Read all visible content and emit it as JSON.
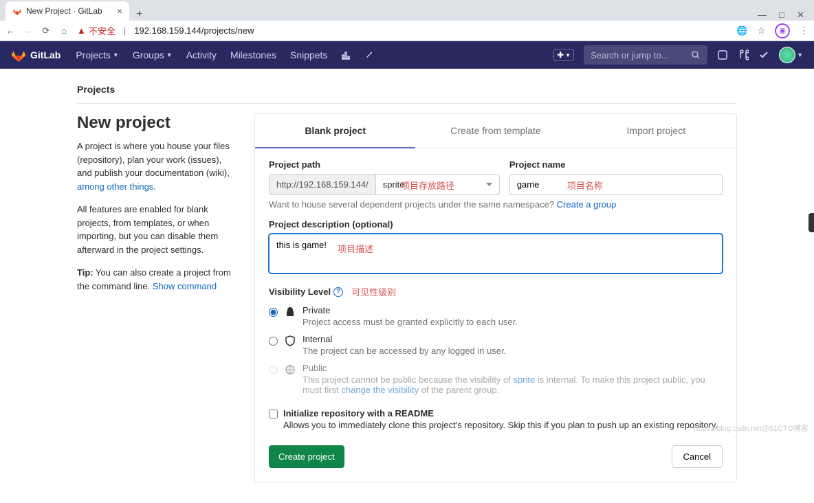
{
  "browser": {
    "tab_title": "New Project · GitLab",
    "insecure_label": "不安全",
    "url": "192.168.159.144/projects/new"
  },
  "header": {
    "brand": "GitLab",
    "nav": {
      "projects": "Projects",
      "groups": "Groups",
      "activity": "Activity",
      "milestones": "Milestones",
      "snippets": "Snippets"
    },
    "search_placeholder": "Search or jump to..."
  },
  "breadcrumb": "Projects",
  "side": {
    "title": "New project",
    "p1a": "A project is where you house your files (repository), plan your work (issues), and publish your documentation (wiki), ",
    "p1_link": "among other things",
    "p2": "All features are enabled for blank projects, from templates, or when importing, but you can disable them afterward in the project settings.",
    "tip_label": "Tip:",
    "tip_text": " You can also create a project from the command line. ",
    "tip_link": "Show command"
  },
  "tabs": {
    "blank": "Blank project",
    "template": "Create from template",
    "import": "Import project"
  },
  "form": {
    "path_label": "Project path",
    "path_prefix": "http://192.168.159.144/",
    "path_namespace": "sprite",
    "name_label": "Project name",
    "name_value": "game",
    "house_hint": "Want to house several dependent projects under the same namespace? ",
    "create_group": "Create a group",
    "desc_label": "Project description (optional)",
    "desc_value": "this is game!",
    "vis_label": "Visibility Level",
    "private_title": "Private",
    "private_sub": "Project access must be granted explicitly to each user.",
    "internal_title": "Internal",
    "internal_sub": "The project can be accessed by any logged in user.",
    "public_title": "Public",
    "public_sub_a": "This project cannot be public because the visibility of ",
    "public_sub_link1": "sprite",
    "public_sub_b": " is internal. To make this project public, you must first ",
    "public_sub_link2": "change the visibility",
    "public_sub_c": " of the parent group.",
    "readme_title": "Initialize repository with a README",
    "readme_sub": "Allows you to immediately clone this project's repository. Skip this if you plan to push up an existing repository.",
    "create_btn": "Create project",
    "cancel_btn": "Cancel"
  },
  "annotations": {
    "path": "项目存放路径",
    "name": "项目名称",
    "desc": "项目描述",
    "vis": "可见性级别"
  },
  "watermark": "https://blog.csdn.net@51CTO博客"
}
